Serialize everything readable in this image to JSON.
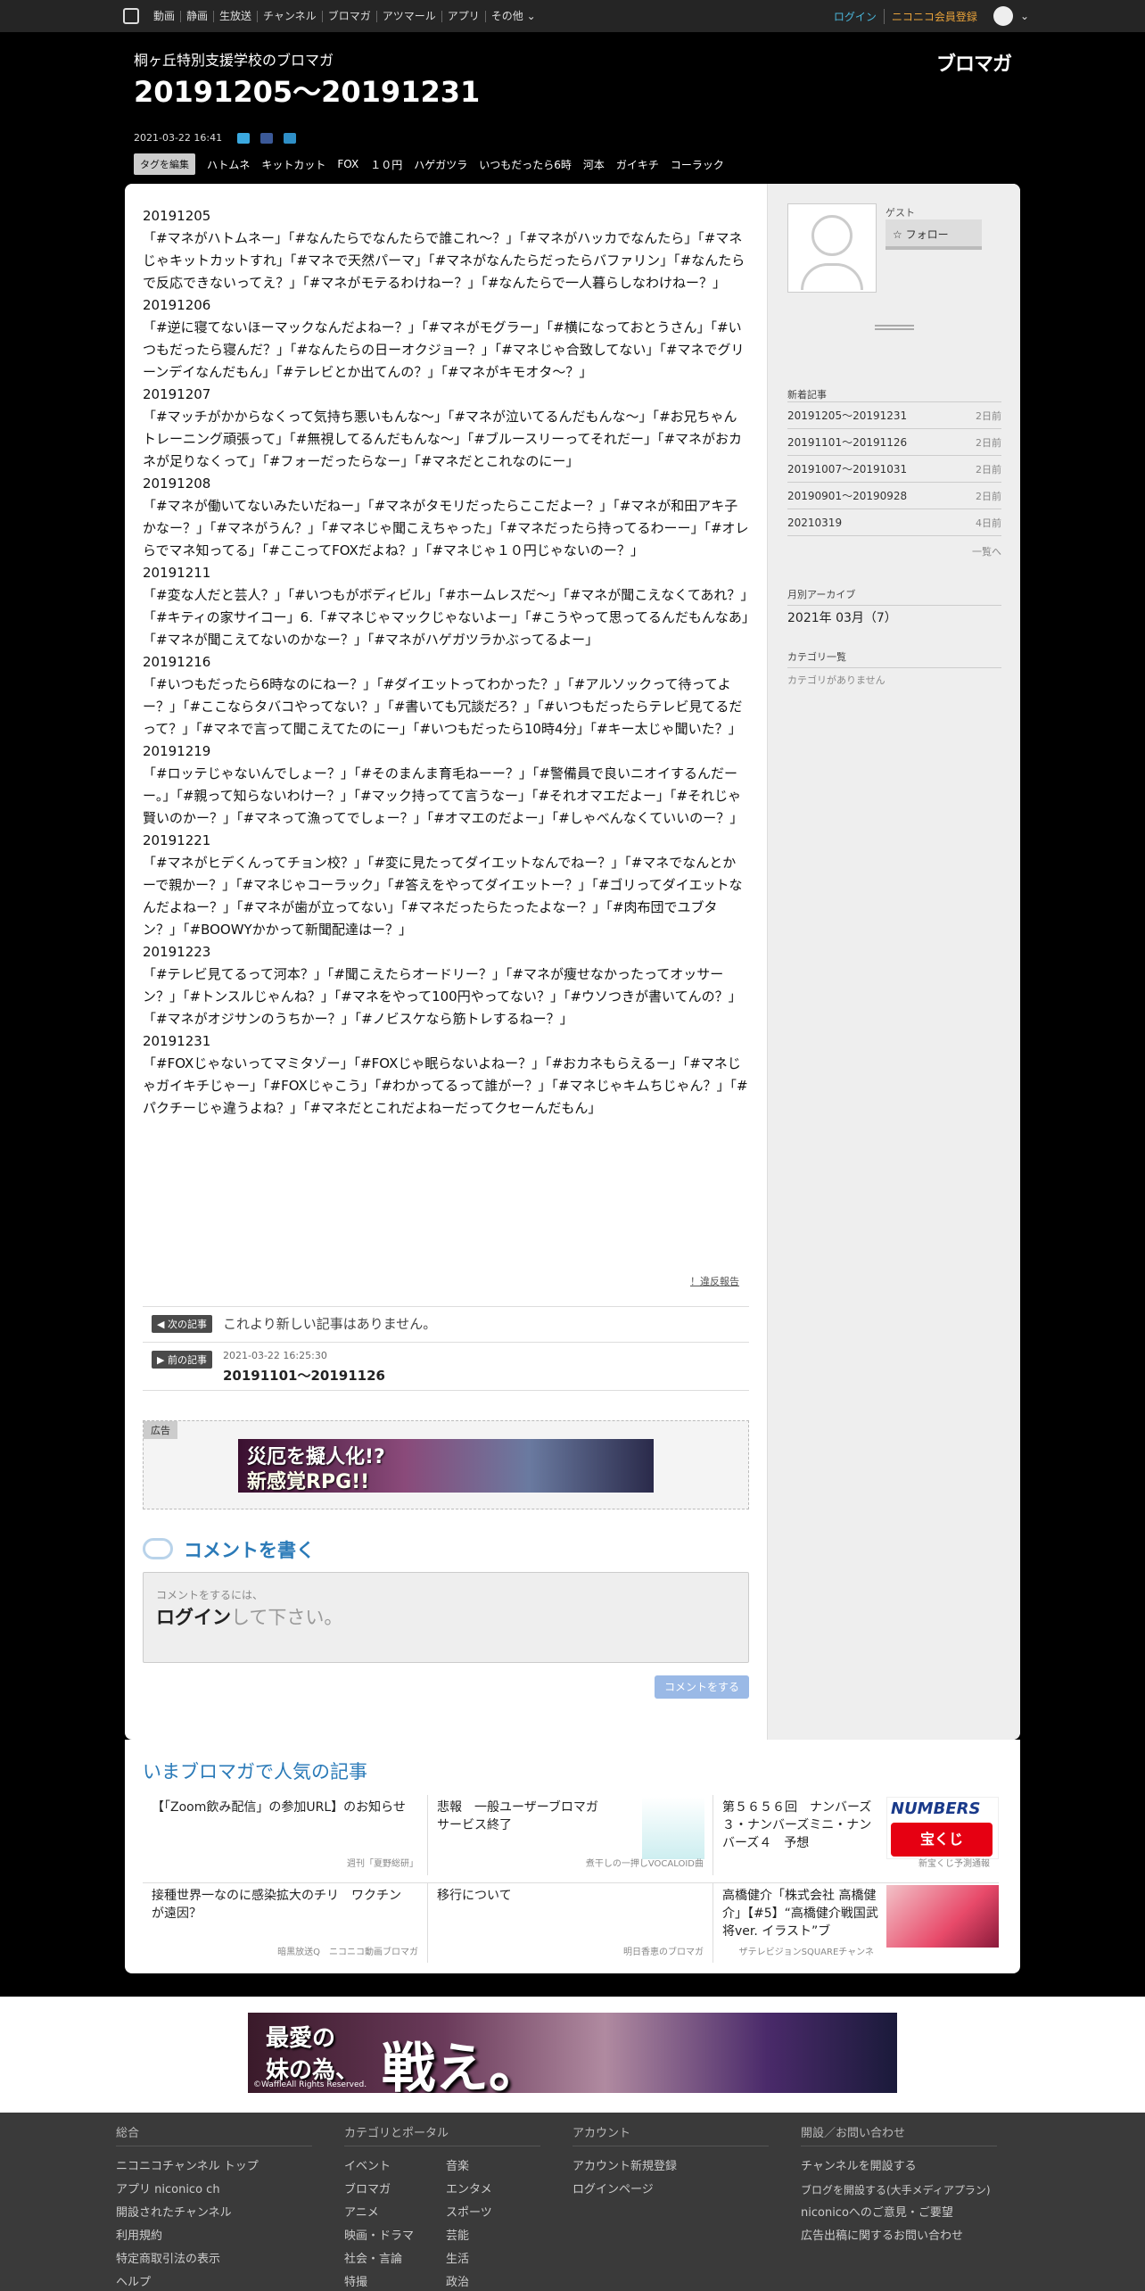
{
  "nav": {
    "items": [
      "動画",
      "静画",
      "生放送",
      "チャンネル",
      "ブロマガ",
      "アツマール",
      "アプリ",
      "その他"
    ],
    "login": "ログイン",
    "premium": "ニコニコ会員登録"
  },
  "header": {
    "blog_name": "桐ヶ丘特別支援学校のブロマガ",
    "title": "20191205～20191231",
    "logo": "ブロマガ",
    "date": "2021-03-22 16:41",
    "tag_edit": "タグを編集",
    "tags": [
      "ハトムネ",
      "キットカット",
      "FOX",
      "１０円",
      "ハゲガツラ",
      "いつもだったら6時",
      "河本",
      "ガイキチ",
      "コーラック"
    ]
  },
  "article": {
    "paragraphs": [
      "20191205",
      "「#マネがハトムネー」「#なんたらでなんたらで誰これ〜？」「#マネがハッカでなんたら」「#マネじゃキットカットすれ」「#マネで天然パーマ」「#マネがなんたらだったらバファリン」「#なんたらで反応できないってえ？」「#マネがモテるわけねー？」「#なんたらで一人暮らしなわけねー？」",
      "20191206",
      "「#逆に寝てないほーマックなんだよねー？」「#マネがモグラー」「#横になっておとうさん」「#いつもだったら寝んだ？」「#なんたらの日ーオクジョー？」「#マネじゃ合致してない」「#マネでグリーンデイなんだもん」「#テレビとか出てんの？」「#マネがキモオタ〜？」",
      "20191207",
      "「#マッチがかからなくって気持ち悪いもんな〜」「#マネが泣いてるんだもんな〜」「#お兄ちゃんトレーニング頑張って」「#無視してるんだもんな〜」「#ブルースリーってそれだー」「#マネがおカネが足りなくって」「#フォーだったらなー」「#マネだとこれなのにー」",
      "20191208",
      "「#マネが働いてないみたいだねー」「#マネがタモリだったらここだよー？」「#マネが和田アキ子かなー？」「#マネがうん？」「#マネじゃ聞こえちゃった」「#マネだったら持ってるわーー」「#オレらでマネ知ってる」「#ここってFOXだよね？」「#マネじゃ１０円じゃないのー？」",
      "20191211",
      "「#変な人だと芸人？」「#いつもがボディビル」「#ホームレスだ〜」「#マネが聞こえなくてあれ？」「#キティの家サイコー」6.「#マネじゃマックじゃないよー」「#こうやって思ってるんだもんなあ」「#マネが聞こえてないのかなー？」「#マネがハゲガツラかぶってるよー」",
      "20191216",
      "「#いつもだったら6時なのにねー？」「#ダイエットってわかった？」「#アルソックって待ってよー？」「#ここならタバコやってない？」「#書いても冗談だろ？」「#いつもだったらテレビ見てるだって？」「#マネで言って聞こえてたのにー」「#いつもだったら10時4分」「#キー太じゃ聞いた？」",
      "20191219",
      "「#ロッテじゃないんでしょー？」「#そのまんま育毛ねーー？」「#警備員で良いニオイするんだーー。」「#親って知らないわけー？」「#マック持ってて言うなー」「#それオマエだよー」「#それじゃ賢いのかー？」「#マネって漁ってでしょー？」「#オマエのだよー」「#しゃべんなくていいのー？」",
      "20191221",
      "「#マネがヒデくんってチョン校？」「#変に見たってダイエットなんでねー？」「#マネでなんとかーで親かー？」「#マネじゃコーラック」「#答えをやってダイエットー？」「#ゴリってダイエットなんだよねー？」「#マネが歯が立ってない」「#マネだったらたったよなー？」「#肉布団でユブタン？」「#BOOWYかかって新聞配達はー？」",
      "20191223",
      "「#テレビ見てるって河本？」「#聞こえたらオードリー？」「#マネが痩せなかったってオッサーン？」「#トンスルじゃんね？」「#マネをやって100円やってない？」「#ウソつきが書いてんの？」「#マネがオジサンのうちかー？」「#ノビスケなら筋トレするねー？」",
      "20191231",
      "「#FOXじゃないってマミタゾー」「#FOXじゃ眠らないよねー？」「#おカネもらえるー」「#マネじゃガイキチじゃー」「#FOXじゃこう」「#わかってるって誰がー？」「#マネじゃキムちじゃん？」「#パクチーじゃ違うよね？」「#マネだとこれだよねーだってクセーんだもん」"
    ]
  },
  "report": "！違反報告",
  "next": {
    "badge": "次の記事",
    "text": "これより新しい記事はありません。"
  },
  "prev": {
    "badge": "前の記事",
    "date": "2021-03-22 16:25:30",
    "title": "20191101～20191126"
  },
  "ad": {
    "label": "広告",
    "line1": "災厄を擬人化!?",
    "line2": "新感覚RPG!!"
  },
  "comment": {
    "heading": "コメントを書く",
    "hint": "コメントをするには、",
    "login": "ログイン",
    "login_suffix": "して下さい。",
    "button": "コメントをする"
  },
  "sidebar": {
    "guest": "ゲスト",
    "follow": "フォロー",
    "new_head": "新着記事",
    "new_items": [
      {
        "title": "20191205～20191231",
        "ago": "2日前"
      },
      {
        "title": "20191101～20191126",
        "ago": "2日前"
      },
      {
        "title": "20191007～20191031",
        "ago": "2日前"
      },
      {
        "title": "20190901～20190928",
        "ago": "2日前"
      },
      {
        "title": "20210319",
        "ago": "4日前"
      }
    ],
    "more": "一覧へ",
    "archive_head": "月別アーカイブ",
    "archive_item": "2021年 03月（7）",
    "category_head": "カテゴリ一覧",
    "category_none": "カテゴリがありません"
  },
  "popular": {
    "heading": "いまブロマガで人気の記事",
    "items": [
      {
        "title": "【「Zoom飲み配信」の参加URL】のお知らせ",
        "source": "週刊「夏野総研」"
      },
      {
        "title": "悲報　一般ユーザーブロマガサービス終了",
        "source": "煮干しの一押しVOCALOID曲"
      },
      {
        "title": "第５６５６回　ナンバーズ３・ナンバーズミニ・ナンバーズ４　予想",
        "source": "新宝くじ予測通報"
      },
      {
        "title": "接種世界一なのに感染拡大のチリ　ワクチンが遠因？",
        "source": "暗黒放送Q　ニコニコ動画ブロマガ"
      },
      {
        "title": "移行について",
        "source": "明日香恵のブロマガ"
      },
      {
        "title": "高橋健介「株式会社 高橋健介」【#5】“高橋健介戦国武将ver. イラスト”ブ",
        "source": "ザテレビジョンSQUAREチャンネ"
      }
    ],
    "thumb3_text": "NUMBERS",
    "thumb3_sub": "宝くじ"
  },
  "bottom_banner": {
    "line1": "最愛の",
    "line2": "妹の為、",
    "big": "戦え。",
    "copy": "©WaffleAll Rights Reserved."
  },
  "footer": {
    "col1": {
      "head": "総合",
      "links": [
        "ニコニコチャンネル トップ",
        "アプリ niconico ch",
        "開設されたチャンネル",
        "利用規約",
        "特定商取引法の表示",
        "ヘルプ"
      ]
    },
    "col2": {
      "head": "カテゴリとポータル",
      "links_a": [
        "イベント",
        "ブロマガ",
        "アニメ",
        "映画・ドラマ",
        "社会・言論",
        "特撮"
      ],
      "links_b": [
        "音楽",
        "エンタメ",
        "スポーツ",
        "芸能",
        "生活",
        "政治"
      ]
    },
    "col3": {
      "head": "アカウント",
      "links": [
        "アカウント新規登録",
        "ログインページ"
      ]
    },
    "col4": {
      "head": "開設／お問い合わせ",
      "links": [
        "チャンネルを開設する",
        "ブログを開設する(大手メディアプラン)",
        "niconicoへのご意見・ご要望",
        "広告出稿に関するお問い合わせ"
      ]
    }
  }
}
